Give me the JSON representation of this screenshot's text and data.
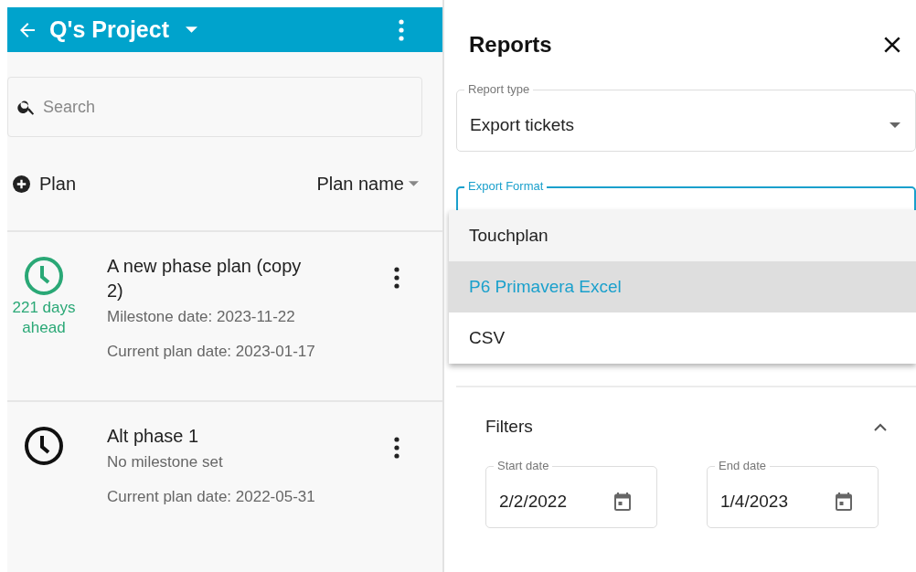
{
  "project_bar": {
    "title": "Q's Project"
  },
  "search": {
    "placeholder": "Search"
  },
  "list_header": {
    "add_label": "Plan",
    "sort_label": "Plan name"
  },
  "plans": [
    {
      "name": "A new phase plan (copy 2)",
      "kind": "ahead",
      "status": "221 days ahead",
      "milestone": "Milestone date: 2023-11-22",
      "current": "Current plan date: 2023-01-17"
    },
    {
      "name": "Alt phase 1",
      "kind": "none",
      "milestone": "No milestone set",
      "current": "Current plan date: 2022-05-31"
    }
  ],
  "reports": {
    "title": "Reports",
    "report_type": {
      "label": "Report type",
      "value": "Export tickets"
    },
    "export_format": {
      "label": "Export Format",
      "options": [
        {
          "label": "Touchplan",
          "selected": false
        },
        {
          "label": "P6 Primavera Excel",
          "selected": true
        },
        {
          "label": "CSV",
          "selected": false
        }
      ]
    },
    "filters": {
      "title": "Filters",
      "expanded": true,
      "start_date": {
        "label": "Start date",
        "value": "2/2/2022"
      },
      "end_date": {
        "label": "End date",
        "value": "1/4/2023"
      }
    }
  }
}
